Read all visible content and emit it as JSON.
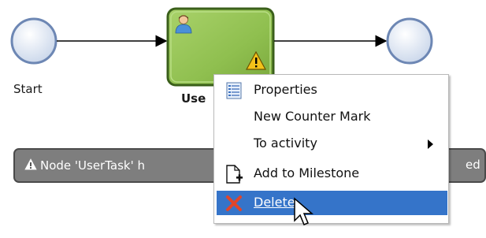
{
  "diagram": {
    "start_label": "Start",
    "task_label": "Use"
  },
  "warning": {
    "text": "Node 'UserTask' h",
    "tail_text": "ed",
    "icon": "warning-triangle-icon"
  },
  "context_menu": {
    "items": [
      {
        "label": "Properties",
        "icon": "properties-icon",
        "submenu": false
      },
      {
        "label": "New Counter Mark",
        "icon": "",
        "submenu": false
      },
      {
        "label": "To activity",
        "icon": "",
        "submenu": true
      },
      {
        "label": "Add to Milestone",
        "icon": "add-to-milestone-icon",
        "submenu": false
      },
      {
        "label": "Delete",
        "icon": "delete-icon",
        "submenu": false,
        "highlighted": true
      }
    ]
  },
  "colors": {
    "menu_highlight": "#3574c9",
    "task_fill": "#8fbf4f",
    "task_border": "#3a5f1a",
    "event_fill": "#dde6f4",
    "warning_bar": "#7e7e7e",
    "delete_x": "#e0452b"
  }
}
